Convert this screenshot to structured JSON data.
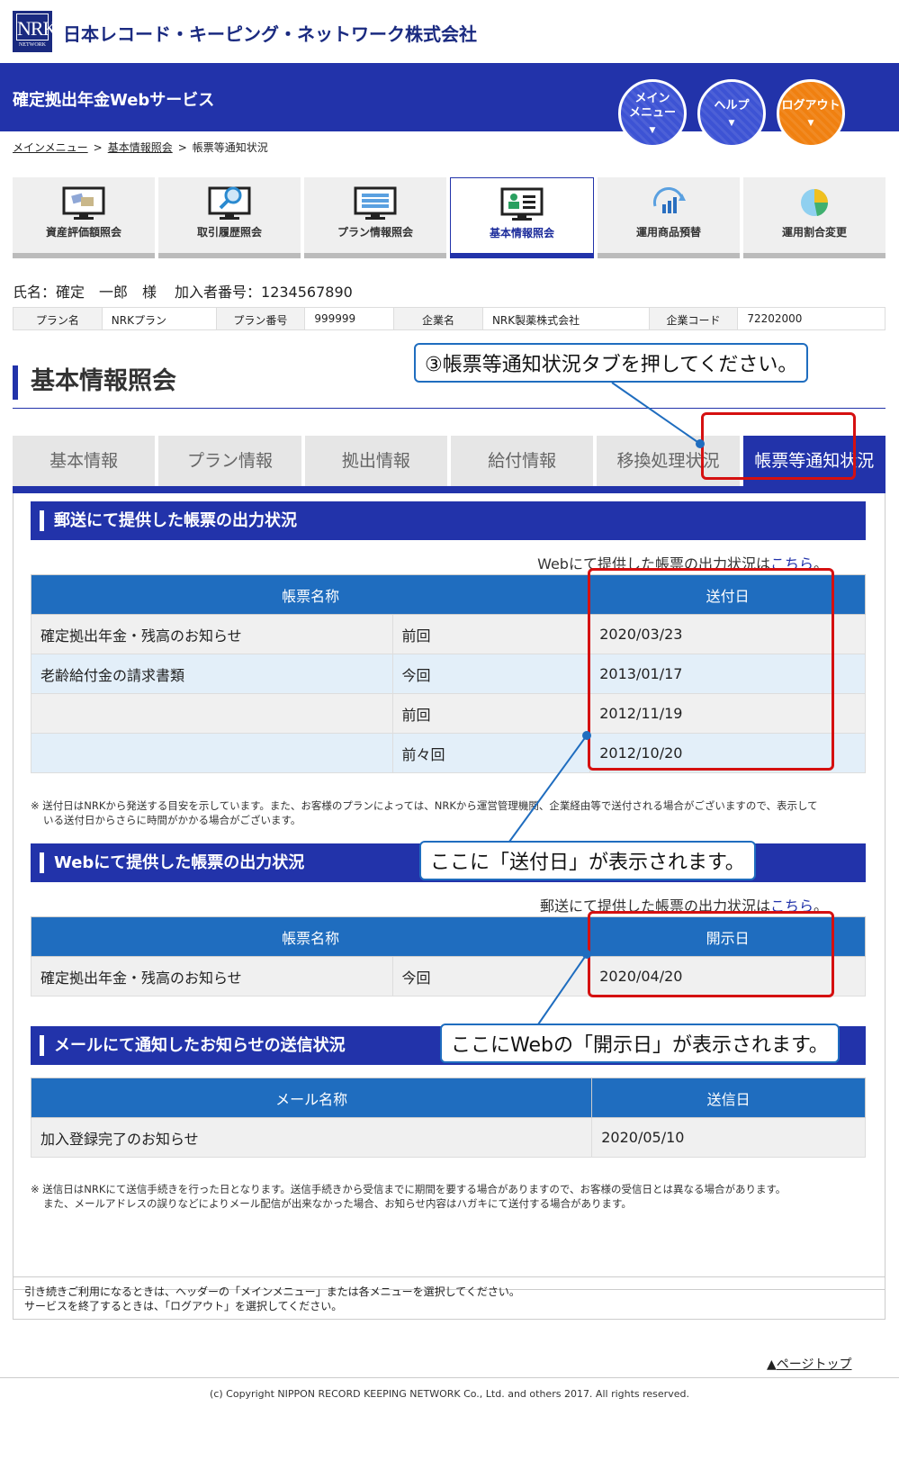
{
  "header": {
    "logo_text": "NRK",
    "logo_sub": "NETWORK",
    "company": "日本レコード・キーピング・ネットワーク株式会社",
    "service": "確定拠出年金Webサービス",
    "buttons": [
      {
        "label1": "メイン",
        "label2": "メニュー",
        "icon": "chevron-down-icon"
      },
      {
        "label1": "ヘルプ",
        "label2": "",
        "icon": "chevron-down-icon"
      },
      {
        "label1": "ログアウト",
        "label2": "",
        "icon": "chevron-down-icon"
      }
    ]
  },
  "breadcrumb": {
    "items": [
      "メインメニュー",
      "基本情報照会",
      "帳票等通知状況"
    ],
    "sep": ">"
  },
  "nav": [
    {
      "label": "資産評価額照会",
      "icon": "asset-monitor-icon"
    },
    {
      "label": "取引履歴照会",
      "icon": "search-monitor-icon"
    },
    {
      "label": "プラン情報照会",
      "icon": "plan-monitor-icon"
    },
    {
      "label": "基本情報照会",
      "icon": "user-monitor-icon"
    },
    {
      "label": "運用商品預替",
      "icon": "refresh-chart-icon"
    },
    {
      "label": "運用割合変更",
      "icon": "pie-chart-icon"
    }
  ],
  "user": {
    "name_label": "氏名：確定　一郎　様",
    "member_label": "加入者番号：1234567890"
  },
  "info": {
    "plan_name_key": "プラン名",
    "plan_name": "NRKプラン",
    "plan_no_key": "プラン番号",
    "plan_no": "999999",
    "company_key": "企業名",
    "company": "NRK製薬株式会社",
    "company_code_key": "企業コード",
    "company_code": "72202000"
  },
  "page_title": "基本情報照会",
  "tabs": [
    "基本情報",
    "プラン情報",
    "拠出情報",
    "給付情報",
    "移換処理状況",
    "帳票等通知状況"
  ],
  "section1": {
    "title": "郵送にて提供した帳票の出力状況",
    "link_pre": "Webにて提供した帳票の出力状況は",
    "link": "こちら",
    "link_post": "。",
    "col1": "帳票名称",
    "col2": "送付日",
    "rows": [
      {
        "name": "確定拠出年金・残高のお知らせ",
        "when": "前回",
        "date": "2020/03/23"
      },
      {
        "name": "老齢給付金の請求書類",
        "when": "今回",
        "date": "2013/01/17"
      },
      {
        "name": "",
        "when": "前回",
        "date": "2012/11/19"
      },
      {
        "name": "",
        "when": "前々回",
        "date": "2012/10/20"
      }
    ],
    "note1": "※ 送付日はNRKから発送する目安を示しています。また、お客様のプランによっては、NRKから運営管理機関、企業経由等で送付される場合がございますので、表示して",
    "note2": "いる送付日からさらに時間がかかる場合がございます。"
  },
  "section2": {
    "title": "Webにて提供した帳票の出力状況",
    "link_pre": "郵送にて提供した帳票の出力状況は",
    "link": "こちら",
    "link_post": "。",
    "col1": "帳票名称",
    "col2": "開示日",
    "rows": [
      {
        "name": "確定拠出年金・残高のお知らせ",
        "when": "今回",
        "date": "2020/04/20"
      }
    ]
  },
  "section3": {
    "title": "メールにて通知したお知らせの送信状況",
    "col1": "メール名称",
    "col2": "送信日",
    "rows": [
      {
        "name": "加入登録完了のお知らせ",
        "date": "2020/05/10"
      }
    ],
    "note1": "※ 送信日はNRKにて送信手続きを行った日となります。送信手続きから受信までに期間を要する場合がありますので、お客様の受信日とは異なる場合があります。",
    "note2": "また、メールアドレスの誤りなどによりメール配信が出来なかった場合、お知らせ内容はハガキにて送付する場合があります。"
  },
  "callouts": {
    "tab": "③帳票等通知状況タブを押してください。",
    "sent": "ここに「送付日」が表示されます。",
    "web": "ここにWebの「開示日」が表示されます。"
  },
  "footer": {
    "line1": "引き続きご利用になるときは、ヘッダーの「メインメニュー」または各メニューを選択してください。",
    "line2": "サービスを終了するときは、「ログアウト」を選択してください。",
    "pagetop": "ページトップ",
    "copyright": "(c) Copyright NIPPON RECORD KEEPING NETWORK Co., Ltd. and others 2017. All rights reserved."
  },
  "colors": {
    "primary": "#2233aa",
    "table_header": "#1f6dbf",
    "highlight": "#d51010",
    "logout": "#f08010"
  }
}
